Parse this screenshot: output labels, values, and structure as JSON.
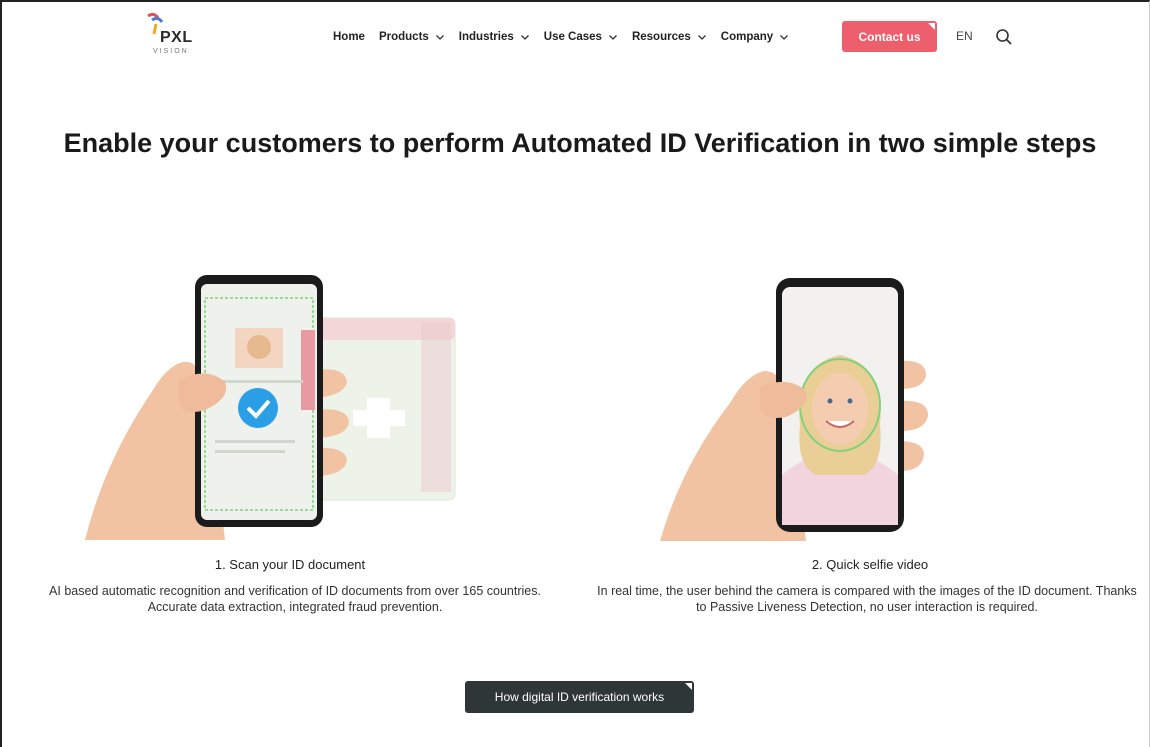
{
  "header": {
    "logo_text": "PXL",
    "logo_subtext": "VISION",
    "nav": [
      {
        "label": "Home",
        "has_dropdown": false
      },
      {
        "label": "Products",
        "has_dropdown": true
      },
      {
        "label": "Industries",
        "has_dropdown": true
      },
      {
        "label": "Use Cases",
        "has_dropdown": true
      },
      {
        "label": "Resources",
        "has_dropdown": true
      },
      {
        "label": "Company",
        "has_dropdown": true
      }
    ],
    "contact_label": "Contact us",
    "language": "EN",
    "search_icon": "search-icon"
  },
  "hero": {
    "headline": "Enable your customers to perform Automated ID Verification in two simple steps"
  },
  "steps": [
    {
      "title": "1. Scan your ID document",
      "description": "AI based automatic recognition and verification of ID documents from over 165 countries. Accurate data extraction, integrated fraud prevention."
    },
    {
      "title": "2. Quick selfie video",
      "description": "In real time, the user behind the camera is compared with the images of the ID document. Thanks to Passive Liveness Detection, no user interaction is required."
    }
  ],
  "cta": {
    "label": "How digital ID verification works"
  },
  "colors": {
    "accent": "#ee5f6e",
    "cta_bg": "#2f3638"
  }
}
